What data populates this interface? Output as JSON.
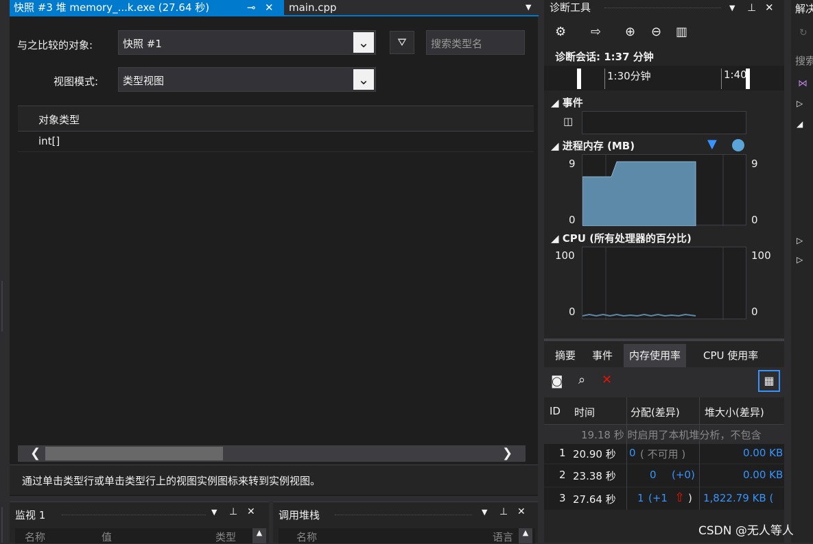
{
  "tabs": {
    "active_label": "快照 #3 堆 memory_...k.exe (27.64 秒)",
    "second_label": "main.cpp"
  },
  "snapshot": {
    "compare_label": "与之比较的对象:",
    "compare_value": "快照 #1",
    "search_placeholder": "搜索类型名",
    "view_mode_label": "视图模式:",
    "view_mode_value": "类型视图",
    "column_header": "对象类型",
    "rows": [
      "int[]"
    ],
    "status_message": "通过单击类型行或单击类型行上的视图实例图标来转到实例视图。",
    "h_scroll_fraction": 0.35
  },
  "bottom_panels": {
    "watch": {
      "title": "监视 1",
      "col_name": "名称",
      "col_value": "值",
      "col_type": "类型"
    },
    "callstack": {
      "title": "调用堆栈",
      "col_name": "名称",
      "col_lang": "语言"
    }
  },
  "diagnostics": {
    "title": "诊断工具",
    "session": "诊断会话: 1:37 分钟",
    "ruler_tick1": "1:30分钟",
    "ruler_tick2": "1:40",
    "events_label": "事件",
    "memory_label": "进程内存 (MB)",
    "mem_max": "9",
    "mem_min": "0",
    "cpu_label": "CPU (所有处理器的百分比)",
    "cpu_max": "100",
    "cpu_min": "0",
    "tabs": [
      "摘要",
      "事件",
      "内存使用率",
      "CPU 使用率"
    ],
    "active_tab": "内存使用率",
    "table_headers": {
      "id": "ID",
      "time": "时间",
      "alloc": "分配(差异)",
      "heap": "堆大小(差异)"
    },
    "info_row": "19.18 秒 时启用了本机堆分析，不包含",
    "rows": [
      {
        "id": "1",
        "time": "20.90 秒",
        "alloc_count": "0",
        "alloc_diff": "( 不可用 )",
        "heap": "0.00 KB"
      },
      {
        "id": "2",
        "time": "23.38 秒",
        "alloc_count": "0",
        "alloc_diff": "(+0)",
        "heap": "0.00 KB"
      },
      {
        "id": "3",
        "time": "27.64 秒",
        "alloc_count": "1",
        "alloc_diff": "(+1",
        "heap": "1,822.79 KB ("
      }
    ]
  },
  "right_panel": {
    "title": "解决",
    "search": "搜索"
  },
  "watermark": "CSDN @无人等人",
  "colors": {
    "accent": "#007acc",
    "chart_fill": "#5d8aa8",
    "delete_red": "#e51400"
  }
}
